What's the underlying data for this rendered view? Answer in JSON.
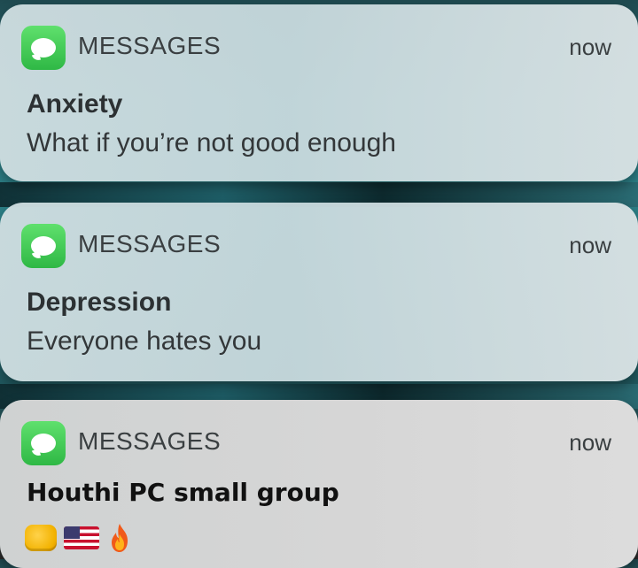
{
  "notifications": [
    {
      "app": "MESSAGES",
      "time": "now",
      "title": "Anxiety",
      "message": "What if you’re not good enough"
    },
    {
      "app": "MESSAGES",
      "time": "now",
      "title": "Depression",
      "message": "Everyone hates you"
    },
    {
      "app": "MESSAGES",
      "time": "now",
      "title": "Houthi PC small group",
      "emojis": [
        "fist-emoji",
        "us-flag-emoji",
        "fire-emoji"
      ]
    }
  ],
  "colors": {
    "app_icon_green": "#2fb845",
    "notification_bg": "#c6d8dc"
  }
}
